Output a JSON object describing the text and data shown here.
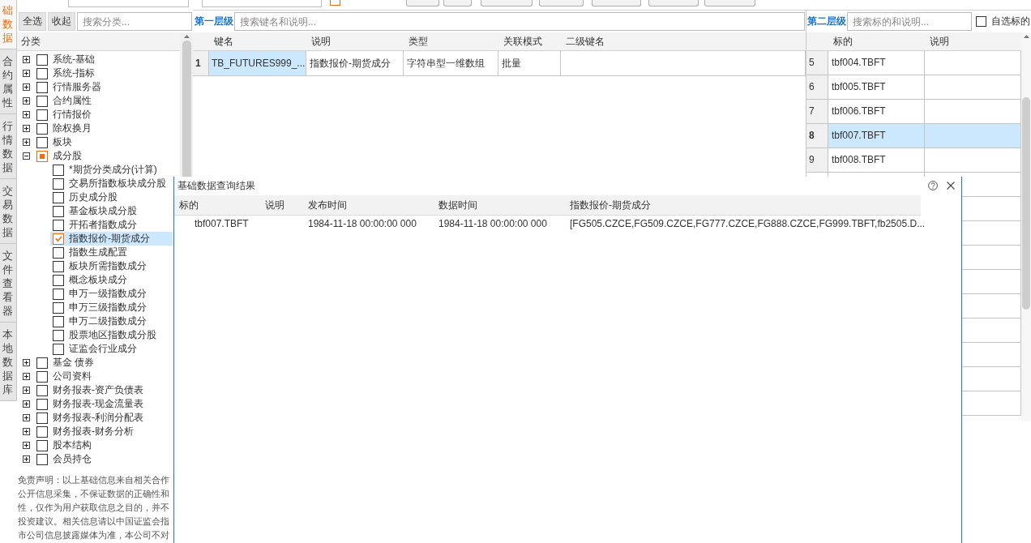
{
  "toolbar": {
    "cross_section": {
      "checked": true
    }
  },
  "side_tabs": [
    {
      "label": "础数据",
      "selected": true
    },
    {
      "label": "合约属性",
      "selected": false
    },
    {
      "label": "行情数据",
      "selected": false
    },
    {
      "label": "交易数据",
      "selected": false
    },
    {
      "label": "文件查看器",
      "selected": false
    },
    {
      "label": "本地数据库",
      "selected": false
    }
  ],
  "category_panel": {
    "select_all": "全选",
    "collapse": "收起",
    "search": {
      "placeholder": "搜索分类..."
    },
    "header": "分类",
    "tree": [
      {
        "label": "系统-基础",
        "expanded": false,
        "checked": false,
        "indeterminate": false,
        "selected": false
      },
      {
        "label": "系统-指标",
        "expanded": false,
        "checked": false,
        "indeterminate": false,
        "selected": false
      },
      {
        "label": "行情服务器",
        "expanded": false,
        "checked": false,
        "indeterminate": false,
        "selected": false
      },
      {
        "label": "合约属性",
        "expanded": false,
        "checked": false,
        "indeterminate": false,
        "selected": false
      },
      {
        "label": "行情报价",
        "expanded": false,
        "checked": false,
        "indeterminate": false,
        "selected": false
      },
      {
        "label": "除权换月",
        "expanded": false,
        "checked": false,
        "indeterminate": false,
        "selected": false
      },
      {
        "label": "板块",
        "expanded": false,
        "checked": false,
        "indeterminate": false,
        "selected": false
      },
      {
        "label": "成分股",
        "expanded": true,
        "checked": false,
        "indeterminate": true,
        "selected": false,
        "children": [
          {
            "label": "*期货分类成分(计算)",
            "checked": false,
            "selected": false
          },
          {
            "label": "交易所指数板块成分股",
            "checked": false,
            "selected": false
          },
          {
            "label": "历史成分股",
            "checked": false,
            "selected": false
          },
          {
            "label": "基金板块成分股",
            "checked": false,
            "selected": false
          },
          {
            "label": "开拓者指数成分",
            "checked": false,
            "selected": false
          },
          {
            "label": "指数报价-期货成分",
            "checked": true,
            "selected": true
          },
          {
            "label": "指数生成配置",
            "checked": false,
            "selected": false
          },
          {
            "label": "板块所需指数成分",
            "checked": false,
            "selected": false
          },
          {
            "label": "概念板块成分",
            "checked": false,
            "selected": false
          },
          {
            "label": "申万一级指数成分",
            "checked": false,
            "selected": false
          },
          {
            "label": "申万三级指数成分",
            "checked": false,
            "selected": false
          },
          {
            "label": "申万二级指数成分",
            "checked": false,
            "selected": false
          },
          {
            "label": "股票地区指数成分股",
            "checked": false,
            "selected": false
          },
          {
            "label": "证监会行业成分",
            "checked": false,
            "selected": false
          }
        ]
      },
      {
        "label": "基金 债券",
        "expanded": false,
        "checked": false,
        "indeterminate": false,
        "selected": false
      },
      {
        "label": "公司资料",
        "expanded": false,
        "checked": false,
        "indeterminate": false,
        "selected": false
      },
      {
        "label": "财务报表-资产负债表",
        "expanded": false,
        "checked": false,
        "indeterminate": false,
        "selected": false
      },
      {
        "label": "财务报表-现金流量表",
        "expanded": false,
        "checked": false,
        "indeterminate": false,
        "selected": false
      },
      {
        "label": "财务报表-利润分配表",
        "expanded": false,
        "checked": false,
        "indeterminate": false,
        "selected": false
      },
      {
        "label": "财务报表-财务分析",
        "expanded": false,
        "checked": false,
        "indeterminate": false,
        "selected": false
      },
      {
        "label": "股本结构",
        "expanded": false,
        "checked": false,
        "indeterminate": false,
        "selected": false
      },
      {
        "label": "会员持仓",
        "expanded": false,
        "checked": false,
        "indeterminate": false,
        "selected": false
      }
    ],
    "disclaimer": [
      "免责声明：以上基础信息来自相关合作",
      "公开信息采集，不保证数据的正确性和",
      "性，仅作为用户获取信息之目的，并不",
      "投资建议。相关信息请以中国证监会指",
      "市公司信息披露媒体为准，本公司不对"
    ]
  },
  "first_level": {
    "label": "第一层级",
    "search": {
      "placeholder": "搜索键名和说明..."
    },
    "columns": [
      "键名",
      "说明",
      "类型",
      "关联模式",
      "二级键名"
    ],
    "rows": [
      {
        "index": "1",
        "selected": true,
        "cells": [
          "TB_FUTURES999_...",
          "指数报价-期货成分",
          "字符串型一维数组",
          "批量"
        ]
      }
    ]
  },
  "second_level": {
    "label": "第二层级",
    "search": {
      "placeholder": "搜索标的和说明..."
    },
    "own_picks": {
      "label": "自选标的",
      "checked": false
    },
    "columns": [
      "标的",
      "说明"
    ],
    "rows": [
      {
        "index": "5",
        "selected": false,
        "cells": [
          "tbf004.TBFT"
        ]
      },
      {
        "index": "6",
        "selected": false,
        "cells": [
          "tbf005.TBFT"
        ]
      },
      {
        "index": "7",
        "selected": false,
        "cells": [
          "tbf006.TBFT"
        ]
      },
      {
        "index": "8",
        "selected": true,
        "cells": [
          "tbf007.TBFT"
        ]
      },
      {
        "index": "9",
        "selected": false,
        "cells": [
          "tbf008.TBFT"
        ]
      }
    ]
  },
  "result_dialog": {
    "title": "基础数据查询结果",
    "columns": [
      "标的",
      "说明",
      "发布时间",
      "数据时间",
      "指数报价-期货成分"
    ],
    "rows": [
      {
        "cells": [
          "tbf007.TBFT",
          null,
          "1984-11-18 00:00:00 000",
          "1984-11-18 00:00:00 000",
          "[FG505.CZCE,FG509.CZCE,FG777.CZCE,FG888.CZCE,FG999.TBFT,fb2505.D..."
        ]
      }
    ]
  }
}
